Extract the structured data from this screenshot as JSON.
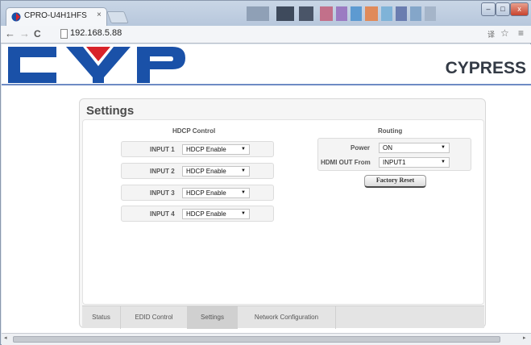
{
  "browser": {
    "tab_title": "CPRO-U4H1HFS",
    "tab_close": "×",
    "url": "192.168.5.88",
    "win_min": "–",
    "win_max": "□",
    "win_close": "x",
    "back": "←",
    "forward": "→",
    "reload": "C",
    "translate_icon": "译",
    "star_icon": "☆",
    "menu_icon": "≡"
  },
  "header": {
    "brand_name": "CYPRESS",
    "accent_color": "#6e8bc4",
    "logo_blue": "#1a51a8",
    "logo_red": "#d8232a"
  },
  "settings": {
    "title": "Settings",
    "hdcp": {
      "heading": "HDCP Control",
      "inputs": [
        {
          "label": "INPUT 1",
          "value": "HDCP Enable"
        },
        {
          "label": "INPUT 2",
          "value": "HDCP Enable"
        },
        {
          "label": "INPUT 3",
          "value": "HDCP Enable"
        },
        {
          "label": "INPUT 4",
          "value": "HDCP Enable"
        }
      ]
    },
    "routing": {
      "heading": "Routing",
      "power_label": "Power",
      "power_value": "ON",
      "hdmi_out_label": "HDMI OUT From",
      "hdmi_out_value": "INPUT1",
      "factory_reset_label": "Factory Reset"
    },
    "tabs": [
      {
        "label": "Status",
        "active": false
      },
      {
        "label": "EDID Control",
        "active": false
      },
      {
        "label": "Settings",
        "active": true
      },
      {
        "label": "Network Configuration",
        "active": false
      }
    ],
    "dropdown_arrow": "▼"
  },
  "scrollbar": {
    "left_arrow": "◂",
    "right_arrow": "▸"
  }
}
